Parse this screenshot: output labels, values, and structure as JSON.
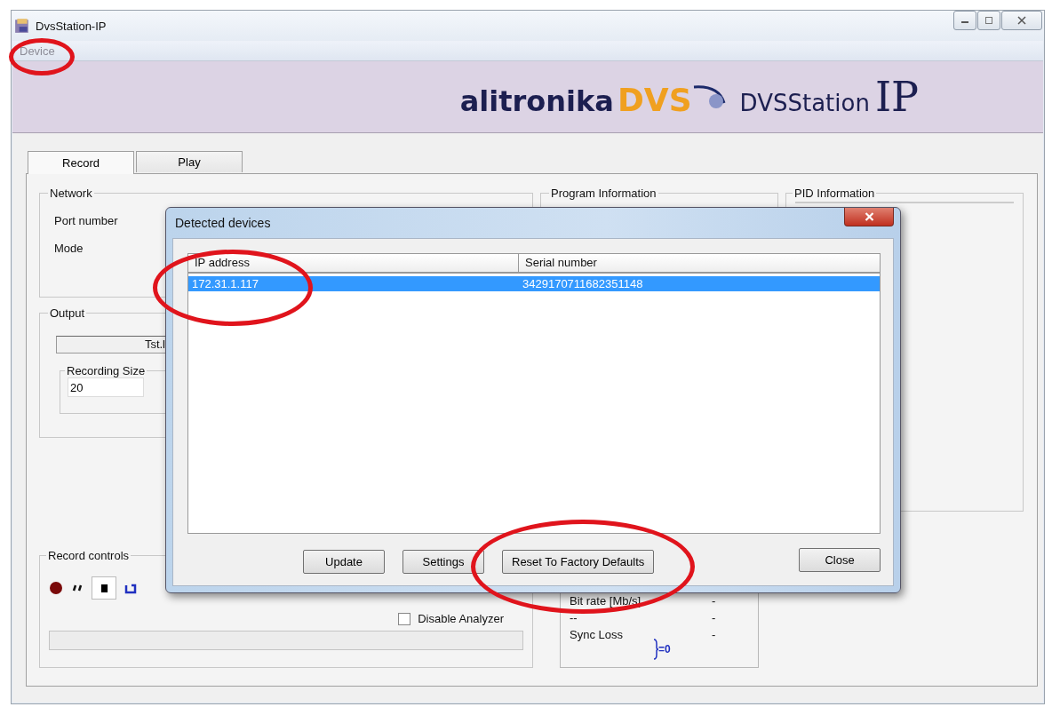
{
  "window": {
    "title": "DvsStation-IP"
  },
  "menu": [
    {
      "label": "Device",
      "disabled": true
    }
  ],
  "banner": {
    "brand": "alitronika",
    "brand_mark": "DVS",
    "product": "DVSStation",
    "product_suffix": "IP"
  },
  "tabs": [
    {
      "label": "Record",
      "selected": true
    },
    {
      "label": "Play",
      "selected": false
    }
  ],
  "network": {
    "title": "Network",
    "fields": [
      "Port number",
      "Mode"
    ]
  },
  "output": {
    "title": "Output",
    "file_value": "Tst.l",
    "recording_size": {
      "label": "Recording Size",
      "value": "20"
    }
  },
  "program_info": {
    "title": "Program Information"
  },
  "pid_info": {
    "title": "PID Information"
  },
  "record_controls": {
    "title": "Record controls",
    "disable_analyzer": {
      "label": "Disable Analyzer",
      "checked": false
    }
  },
  "stats": {
    "rows": [
      {
        "label": "Bit rate [Mb/s]",
        "value": "-"
      },
      {
        "label": "--",
        "value": "-"
      },
      {
        "label": "Sync Loss",
        "value": "-"
      }
    ],
    "sync_indicator": "=0"
  },
  "dialog": {
    "title": "Detected devices",
    "columns": [
      "IP address",
      "Serial number"
    ],
    "rows": [
      {
        "cells": [
          "172.31.1.117",
          "3429170711682351148"
        ],
        "selected": true
      }
    ],
    "buttons": [
      "Update",
      "Settings",
      "Reset To Factory Defaults"
    ],
    "close_button": "Close"
  }
}
